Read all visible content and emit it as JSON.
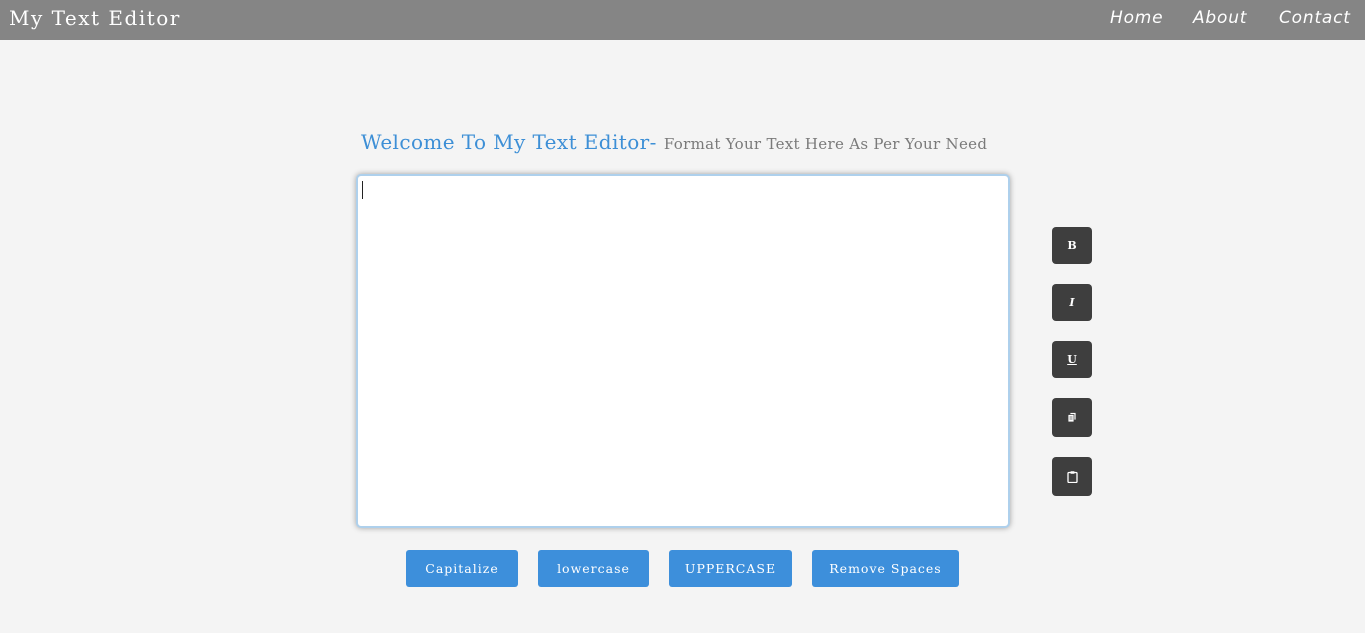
{
  "navbar": {
    "brand": "My Text Editor",
    "links": [
      "Home",
      "About",
      "Contact"
    ]
  },
  "heading": {
    "main": "Welcome To My Text Editor-",
    "sub": "Format Your Text Here As Per Your Need"
  },
  "editor": {
    "value": "",
    "placeholder": ""
  },
  "toolbar": {
    "bold_label": "B",
    "italic_label": "I",
    "underline_label": "U",
    "copy_icon": "copy-icon",
    "paste_icon": "clipboard-icon"
  },
  "actions": {
    "capitalize": "Capitalize",
    "lowercase": "lowercase",
    "uppercase": "UPPERCASE",
    "remove_spaces": "Remove Spaces"
  },
  "colors": {
    "navbar": "#858585",
    "accent": "#3d8fdb",
    "tool_button": "#3e3e3e",
    "background": "#f4f4f4"
  }
}
